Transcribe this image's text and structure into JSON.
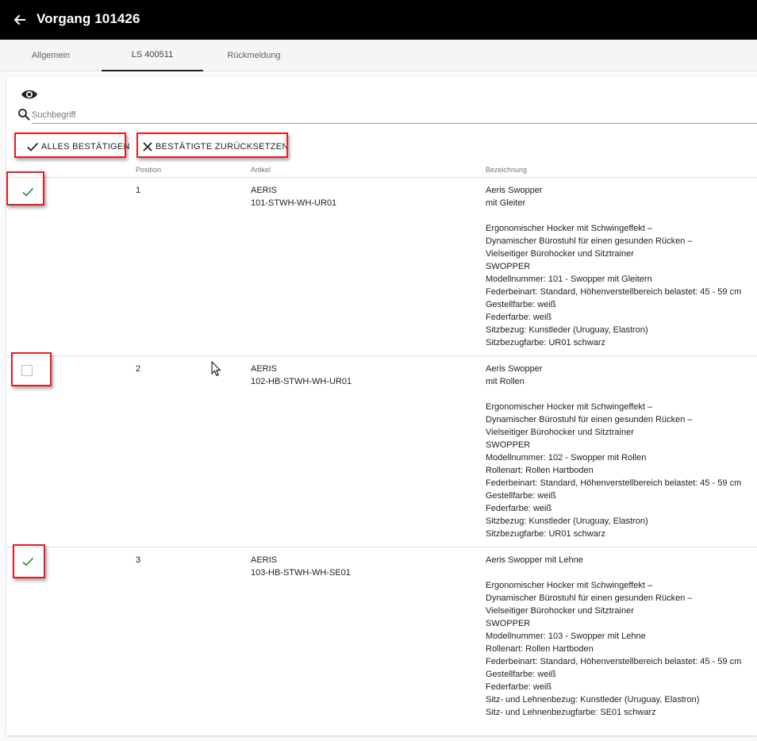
{
  "header": {
    "title": "Vorgang 101426"
  },
  "tabs": [
    {
      "label": "Allgemein"
    },
    {
      "label": "LS 400511"
    },
    {
      "label": "Rückmeldung"
    }
  ],
  "search": {
    "placeholder": "Suchbegriff",
    "value": ""
  },
  "actions": {
    "confirm_all": "ALLES BESTÄTIGEN",
    "reset_confirmed": "BESTÄTIGTE ZURÜCKSETZEN"
  },
  "table": {
    "columns": {
      "position": "Position",
      "article": "Artikel",
      "description": "Bezeichnung"
    },
    "rows": [
      {
        "confirmed": true,
        "position": "1",
        "article": "AERIS\n101-STWH-WH-UR01",
        "description": "Aeris Swopper\nmit Gleiter\n\nErgonomischer Hocker mit Schwingeffekt –\nDynamischer Bürostuhl für einen gesunden Rücken –\nVielseitiger Bürohocker und Sitztrainer\nSWOPPER\nModellnummer: 101 - Swopper mit Gleitern\nFederbeinart: Standard, Höhenverstellbereich belastet: 45 - 59 cm\nGestellfarbe: weiß\nFederfarbe: weiß\nSitzbezug: Kunstleder (Uruguay, Elastron)\nSitzbezugfarbe: UR01 schwarz"
      },
      {
        "confirmed": false,
        "position": "2",
        "article": "AERIS\n102-HB-STWH-WH-UR01",
        "description": "Aeris Swopper\nmit Rollen\n\nErgonomischer Hocker mit Schwingeffekt –\nDynamischer Bürostuhl für einen gesunden Rücken –\nVielseitiger Bürohocker und Sitztrainer\nSWOPPER\nModellnummer: 102 - Swopper mit Rollen\nRollenart: Rollen Hartboden\nFederbeinart: Standard, Höhenverstellbereich belastet: 45 - 59 cm\nGestellfarbe: weiß\nFederfarbe: weiß\nSitzbezug: Kunstleder (Uruguay, Elastron)\nSitzbezugfarbe: UR01 schwarz"
      },
      {
        "confirmed": true,
        "position": "3",
        "article": "AERIS\n103-HB-STWH-WH-SE01",
        "description": "Aeris Swopper mit Lehne\n\nErgonomischer Hocker mit Schwingeffekt –\nDynamischer Bürostuhl für einen gesunden Rücken –\nVielseitiger Bürohocker und Sitztrainer\nSWOPPER\nModellnummer: 103 - Swopper mit Lehne\nRollenart: Rollen Hartboden\nFederbeinart: Standard, Höhenverstellbereich belastet: 45 - 59 cm\nGestellfarbe: weiß\nFederfarbe: weiß\nSitz- und Lehnenbezug: Kunstleder (Uruguay, Elastron)\nSitz- und Lehnenbezugfarbe: SE01 schwarz"
      }
    ]
  },
  "colors": {
    "appbar": "#000000",
    "check": "#2e9e3a",
    "highlight": "#e02020"
  }
}
